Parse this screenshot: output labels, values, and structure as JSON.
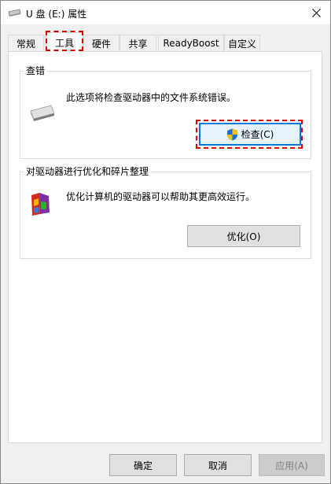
{
  "window": {
    "title": "U 盘 (E:) 属性"
  },
  "tabs": [
    {
      "label": "常规"
    },
    {
      "label": "工具"
    },
    {
      "label": "硬件"
    },
    {
      "label": "共享"
    },
    {
      "label": "ReadyBoost"
    },
    {
      "label": "自定义"
    }
  ],
  "error_check": {
    "legend": "查错",
    "description": "此选项将检查驱动器中的文件系统错误。",
    "button_label": "检查(C)",
    "icon": "drive-icon"
  },
  "optimize": {
    "legend": "对驱动器进行优化和碎片整理",
    "description": "优化计算机的驱动器可以帮助其更高效运行。",
    "button_label": "优化(O)",
    "icon": "defrag-icon"
  },
  "footer": {
    "ok_label": "确定",
    "cancel_label": "取消",
    "apply_label": "应用(A)"
  },
  "colors": {
    "highlight_outline": "#e00000",
    "focus_border": "#0078d7"
  }
}
